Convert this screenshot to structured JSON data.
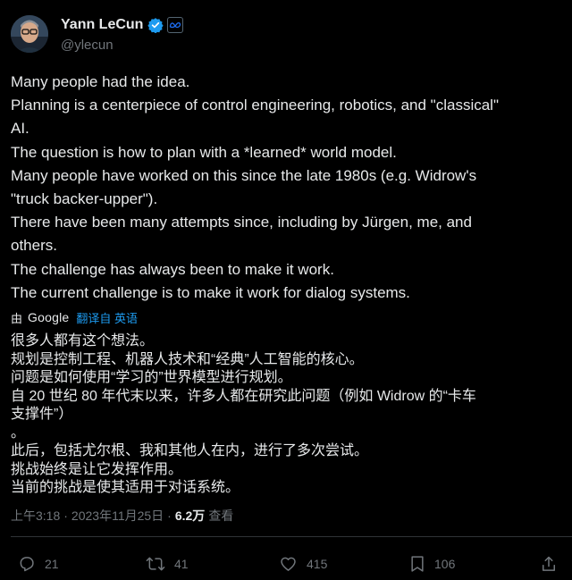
{
  "author": {
    "display_name": "Yann LeCun",
    "handle": "@ylecun"
  },
  "tweet": {
    "lines": [
      "Many people had the idea.",
      "Planning is a centerpiece of control engineering, robotics, and \"classical\"",
      "AI.",
      "The question is how to plan with a *learned* world model.",
      "Many people have worked on this since the late 1980s (e.g. Widrow's",
      "\"truck backer-upper\").",
      "There have been many attempts since, including by Jürgen, me, and",
      "others.",
      "The challenge has always been to make it work.",
      "The current challenge is to make it work for dialog systems."
    ]
  },
  "translation": {
    "by_label": "由",
    "provider": "Google",
    "link_label": "翻译自 英语",
    "lines": [
      "很多人都有这个想法。",
      "规划是控制工程、机器人技术和“经典”人工智能的核心。",
      "问题是如何使用“学习的”世界模型进行规划。",
      "自 20 世纪 80 年代末以来，许多人都在研究此问题（例如 Widrow 的“卡车",
      "支撑件”）",
      "。",
      "此后，包括尤尔根、我和其他人在内，进行了多次尝试。",
      "挑战始终是让它发挥作用。",
      "当前的挑战是使其适用于对话系统。"
    ]
  },
  "meta": {
    "time": "上午3:18",
    "separator": "·",
    "date": "2023年11月25日",
    "views_count": "6.2万",
    "views_label": "查看"
  },
  "actions": {
    "replies": "21",
    "reposts": "41",
    "likes": "415",
    "bookmarks": "106"
  },
  "colors": {
    "background": "#000000",
    "text": "#e7e9ea",
    "secondary": "#71767b",
    "accent": "#1d9bf0",
    "divider": "#2f3336"
  },
  "icons": {
    "verified": "verified-badge-icon",
    "affiliation": "meta-logo-icon",
    "reply": "reply-icon",
    "repost": "repost-icon",
    "like": "like-icon",
    "bookmark": "bookmark-icon",
    "share": "share-icon"
  }
}
